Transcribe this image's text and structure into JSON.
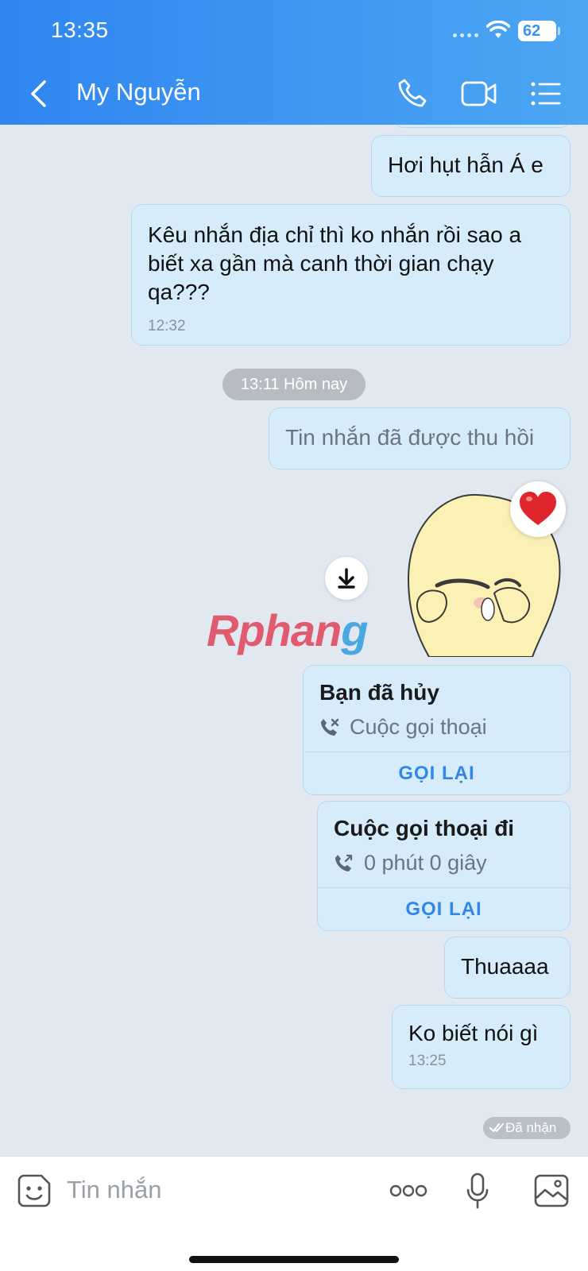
{
  "status_bar": {
    "time": "13:35",
    "battery": "62"
  },
  "header": {
    "title": "My Nguyễn"
  },
  "messages": {
    "m1": {
      "text": "Hơi hụt hẫn Á e"
    },
    "m2": {
      "text": "Kêu nhắn địa chỉ thì ko nhắn rồi sao a biết xa gần mà canh thời gian chạy qa???",
      "time": "12:32"
    },
    "divider": "13:11 Hôm nay",
    "m3": {
      "text": "Tin nhắn đã được thu hồi"
    },
    "watermark": {
      "part1": "Rphan",
      "part2": "g"
    },
    "call1": {
      "title": "Bạn đã hủy",
      "detail": "Cuộc gọi thoại",
      "action": "GỌI LẠI"
    },
    "call2": {
      "title": "Cuộc gọi thoại đi",
      "detail": "0 phút 0 giây",
      "action": "GỌI LẠI"
    },
    "m4": {
      "text": "Thuaaaa"
    },
    "m5": {
      "text": "Ko biết nói gì",
      "time": "13:25"
    },
    "status": "Đã nhận"
  },
  "composer": {
    "placeholder": "Tin nhắn"
  },
  "colors": {
    "header_start": "#2f86f0",
    "header_end": "#4ca6f2",
    "bubble": "#d7ecfb",
    "accent": "#2f87e8"
  }
}
